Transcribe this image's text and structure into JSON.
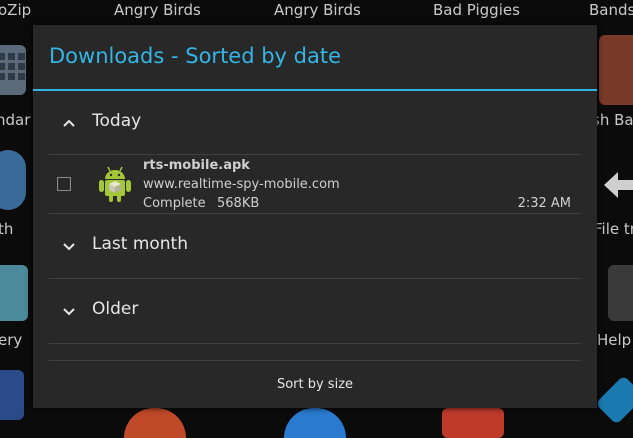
{
  "background": {
    "app_labels": [
      "oZip",
      "Angry Birds",
      "Angry Birds",
      "Bad Piggies",
      "Bands"
    ],
    "side_labels_left": [
      "ndar",
      "th",
      "ery"
    ],
    "side_labels_right": [
      "sh Ba",
      "File tr",
      "Help"
    ]
  },
  "dialog": {
    "title": "Downloads - Sorted by date",
    "sections": [
      {
        "label": "Today",
        "expanded": true,
        "chevron": "chevron-up-icon"
      },
      {
        "label": "Last month",
        "expanded": false,
        "chevron": "chevron-down-icon"
      },
      {
        "label": "Older",
        "expanded": false,
        "chevron": "chevron-down-icon"
      }
    ],
    "download_item": {
      "filename": "rts-mobile.apk",
      "url": "www.realtime-spy-mobile.com",
      "status": "Complete",
      "size": "568KB",
      "time": "2:32 AM",
      "checked": false,
      "icon": "android-package-icon"
    },
    "sort_button": "Sort by size"
  },
  "colors": {
    "accent": "#33b5e5",
    "dialog_bg": "#282828",
    "android_green": "#a4c639"
  }
}
